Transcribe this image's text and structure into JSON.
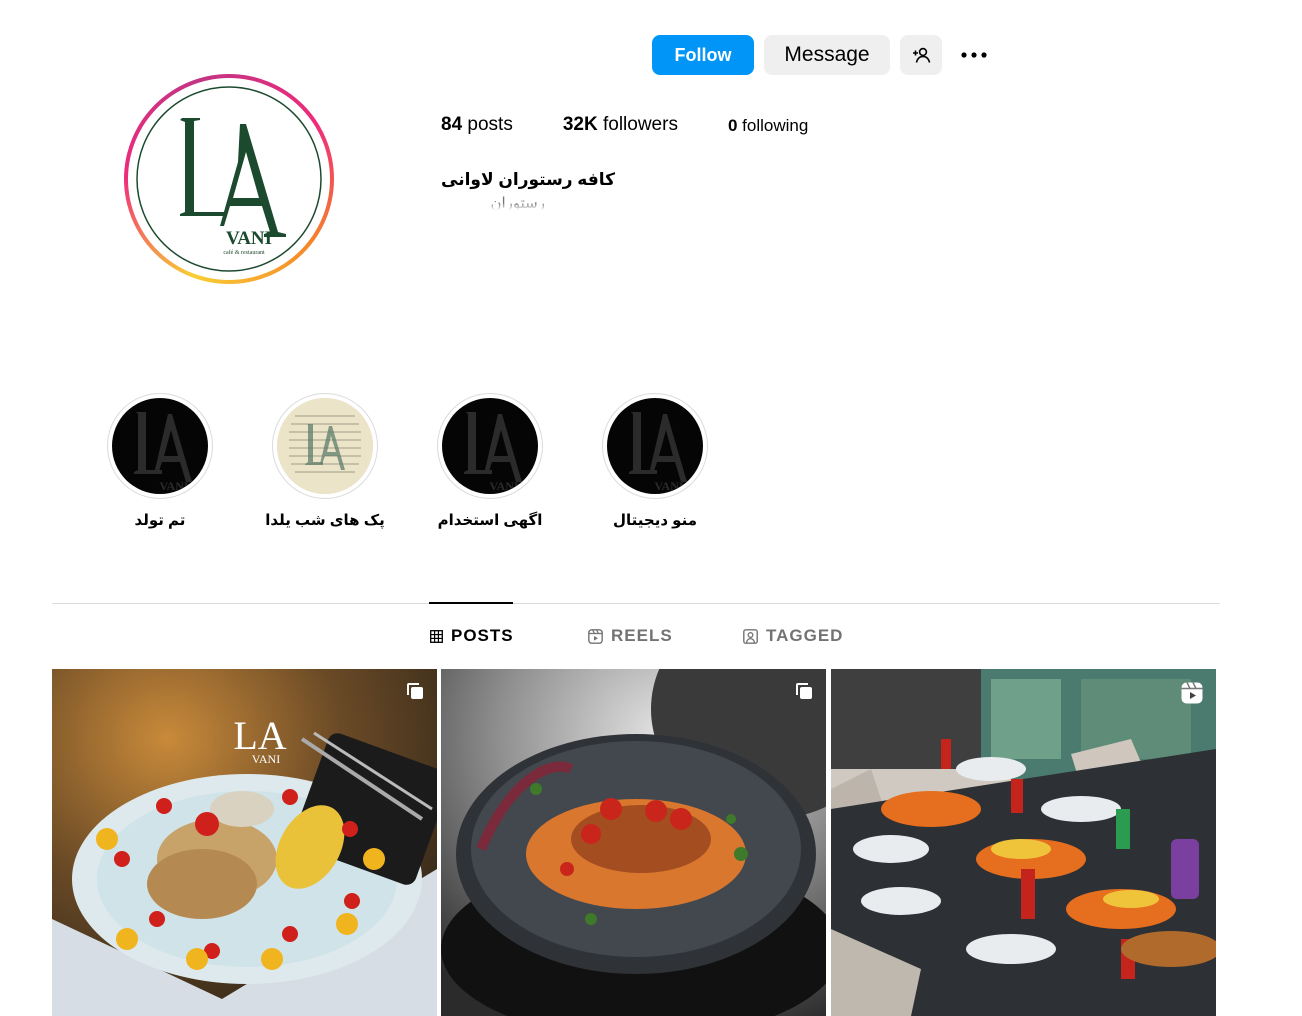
{
  "profile": {
    "name": "کافه رستوران لاوانی",
    "category": "رستوران",
    "avatar_logo": "LAVANI logo — café & restaurant",
    "ring_colors": [
      "#f9ce34",
      "#ee2a7b",
      "#c13584",
      "#f58529"
    ]
  },
  "actions": {
    "follow_label": "Follow",
    "message_label": "Message",
    "suggest_icon": "add-person-icon",
    "more_icon": "ellipsis-icon",
    "follow_color": "#0095f6"
  },
  "stats": {
    "posts_count": "84",
    "posts_label": "posts",
    "followers_count": "32K",
    "followers_label": "followers",
    "following_count": "0",
    "following_label": "following"
  },
  "highlights": [
    {
      "label": "منو دیجیتال",
      "cover": "black-logo"
    },
    {
      "label": "اگهی استخدام",
      "cover": "black-logo"
    },
    {
      "label": "پک های شب یلدا",
      "cover": "paper-logo"
    },
    {
      "label": "تم تولد",
      "cover": "black-logo"
    }
  ],
  "tabs": [
    {
      "label": "POSTS",
      "icon": "grid-icon",
      "active": true
    },
    {
      "label": "REELS",
      "icon": "reels-icon",
      "active": false
    },
    {
      "label": "TAGGED",
      "icon": "tagged-icon",
      "active": false
    }
  ],
  "posts": [
    {
      "kind": "carousel",
      "badge_icon": "carousel-icon",
      "subject": "grilled chicken plate with corn"
    },
    {
      "kind": "carousel",
      "badge_icon": "carousel-icon",
      "subject": "pasta with tomatoes on dark plate"
    },
    {
      "kind": "reel",
      "badge_icon": "reel-icon",
      "subject": "restaurant table set with dishes"
    }
  ]
}
